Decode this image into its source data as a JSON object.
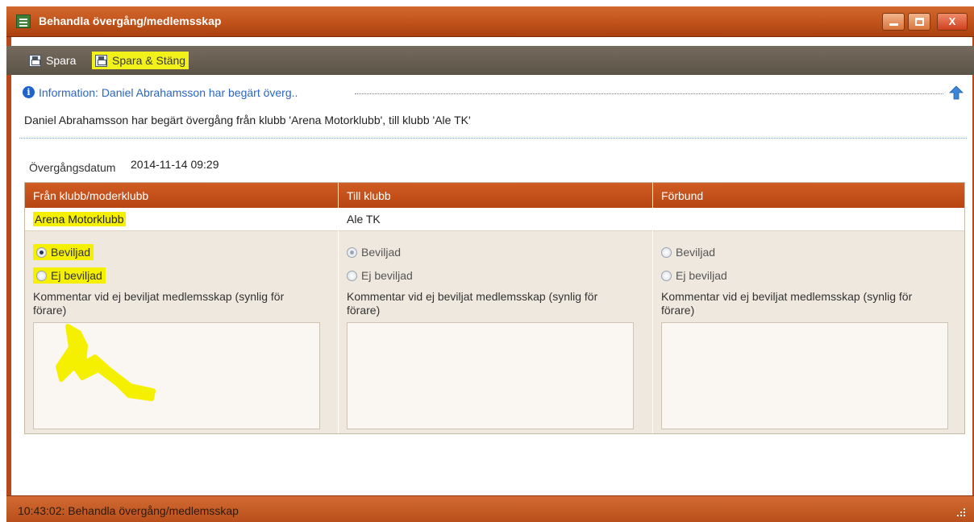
{
  "window": {
    "title": "Behandla övergång/medlemsskap",
    "controls": {
      "minimize": "–",
      "maximize": "□",
      "close": "X"
    }
  },
  "toolbar": {
    "save_label": "Spara",
    "save_close_label": "Spara & Stäng"
  },
  "info": {
    "title": "Information: Daniel Abrahamsson har begärt överg..",
    "text": "Daniel Abrahamsson har begärt övergång från klubb 'Arena Motorklubb', till klubb 'Ale TK'"
  },
  "transfer": {
    "date_label": "Övergångsdatum",
    "date_value": "2014-11-14 09:29"
  },
  "columns": [
    {
      "header": "Från klubb/moderklubb",
      "club": "Arena Motorklubb",
      "approved_label": "Beviljad",
      "denied_label": "Ej beviljad",
      "selected": "Beviljad",
      "comment_label": "Kommentar vid ej beviljat medlemsskap (synlig för förare)",
      "comment_value": ""
    },
    {
      "header": "Till klubb",
      "club": "Ale TK",
      "approved_label": "Beviljad",
      "denied_label": "Ej beviljad",
      "selected": "Beviljad",
      "comment_label": "Kommentar vid ej beviljat medlemsskap (synlig för förare)",
      "comment_value": ""
    },
    {
      "header": "Förbund",
      "club": "",
      "approved_label": "Beviljad",
      "denied_label": "Ej beviljad",
      "selected": "",
      "comment_label": "Kommentar vid ej beviljat medlemsskap (synlig för förare)",
      "comment_value": ""
    }
  ],
  "statusbar": {
    "text": "10:43:02: Behandla övergång/medlemsskap"
  },
  "colors": {
    "accent": "#c0521a",
    "toolbar": "#5c5347",
    "highlight": "#f5f000",
    "info_blue": "#2b66c2"
  },
  "icons": {
    "app": "form-icon",
    "save": "floppy-disk-icon",
    "info": "info-icon",
    "collapse": "arrow-up-icon",
    "resize": "resize-grip-icon"
  }
}
